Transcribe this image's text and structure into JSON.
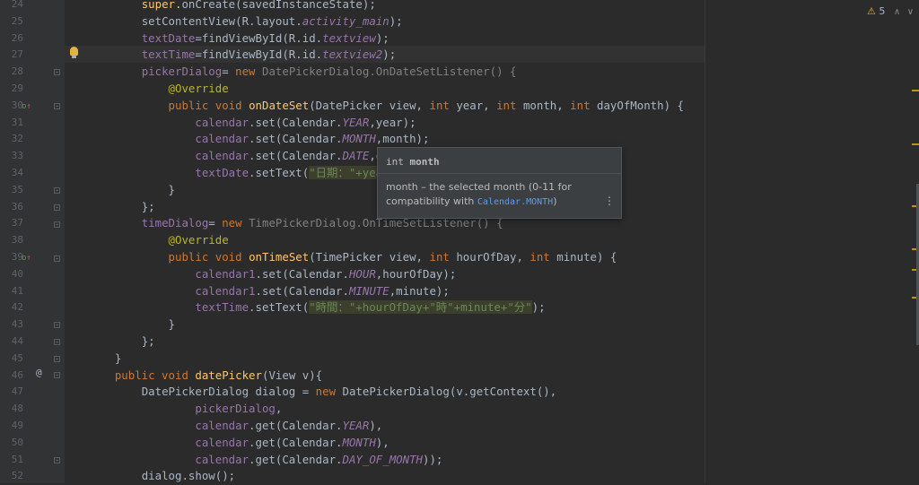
{
  "inspections": {
    "warning_count": "5"
  },
  "lines": [
    {
      "num": "24",
      "fold": false,
      "parts": [
        {
          "t": "super.",
          "c": "fn-plain"
        },
        {
          "t": "onCreate",
          "c": ""
        },
        {
          "t": "(savedInstanceState);",
          "c": ""
        }
      ],
      "indent": "        "
    },
    {
      "num": "25",
      "parts": [
        {
          "t": "setContentView(R.layout.",
          "c": ""
        },
        {
          "t": "activity_main",
          "c": "fi"
        },
        {
          "t": ");",
          "c": ""
        }
      ],
      "indent": "        "
    },
    {
      "num": "26",
      "parts": [
        {
          "t": "textDate",
          "c": "fld"
        },
        {
          "t": "=findViewById(R.id.",
          "c": ""
        },
        {
          "t": "textview",
          "c": "fi"
        },
        {
          "t": ");",
          "c": ""
        }
      ],
      "indent": "        "
    },
    {
      "num": "27",
      "parts": [
        {
          "t": "textTime",
          "c": "fld"
        },
        {
          "t": "=findViewById(R.id.",
          "c": ""
        },
        {
          "t": "textview2",
          "c": "fi"
        },
        {
          "t": ");",
          "c": ""
        }
      ],
      "indent": "        "
    },
    {
      "num": "28",
      "parts": [
        {
          "t": "pickerDialog",
          "c": "fld"
        },
        {
          "t": "= ",
          "c": ""
        },
        {
          "t": "new ",
          "c": "kw"
        },
        {
          "t": "DatePickerDialog.OnDateSetListener",
          "c": "gr"
        },
        {
          "t": "() {",
          "c": "gr"
        }
      ],
      "indent": "        "
    },
    {
      "num": "29",
      "parts": [
        {
          "t": "@Override",
          "c": "ann"
        }
      ],
      "indent": "            "
    },
    {
      "num": "30",
      "parts": [
        {
          "t": "public void ",
          "c": "kw"
        },
        {
          "t": "onDateSet",
          "c": "fn"
        },
        {
          "t": "(DatePicker view, ",
          "c": ""
        },
        {
          "t": "int ",
          "c": "kw"
        },
        {
          "t": "year, ",
          "c": ""
        },
        {
          "t": "int ",
          "c": "kw"
        },
        {
          "t": "month, ",
          "c": ""
        },
        {
          "t": "int ",
          "c": "kw"
        },
        {
          "t": "dayOfMonth) {",
          "c": ""
        }
      ],
      "indent": "            "
    },
    {
      "num": "31",
      "parts": [
        {
          "t": "calendar",
          "c": "fld"
        },
        {
          "t": ".set(Calendar.",
          "c": ""
        },
        {
          "t": "YEAR",
          "c": "fi"
        },
        {
          "t": ",year);",
          "c": ""
        }
      ],
      "indent": "                "
    },
    {
      "num": "32",
      "parts": [
        {
          "t": "calendar",
          "c": "fld"
        },
        {
          "t": ".set(Calendar.",
          "c": ""
        },
        {
          "t": "MONTH",
          "c": "fi"
        },
        {
          "t": ",month);",
          "c": ""
        }
      ],
      "indent": "                "
    },
    {
      "num": "33",
      "parts": [
        {
          "t": "calendar",
          "c": "fld"
        },
        {
          "t": ".set(Calendar.",
          "c": ""
        },
        {
          "t": "DATE",
          "c": "fi"
        },
        {
          "t": ",dayOfM",
          "c": ""
        }
      ],
      "indent": "                "
    },
    {
      "num": "34",
      "parts": [
        {
          "t": "textDate",
          "c": "fld"
        },
        {
          "t": ".setText(",
          "c": ""
        },
        {
          "t": "\"日期：\"",
          "c": "str-hl"
        },
        {
          "t": "+year+",
          "c": "str-hl"
        },
        {
          "t": "\"/\"",
          "c": "str-hl"
        }
      ],
      "indent": "                "
    },
    {
      "num": "35",
      "parts": [
        {
          "t": "}",
          "c": ""
        }
      ],
      "indent": "            "
    },
    {
      "num": "36",
      "parts": [
        {
          "t": "};",
          "c": ""
        }
      ],
      "indent": "        "
    },
    {
      "num": "37",
      "parts": [
        {
          "t": "timeDialog",
          "c": "fld"
        },
        {
          "t": "= ",
          "c": ""
        },
        {
          "t": "new ",
          "c": "kw"
        },
        {
          "t": "TimePickerDialog.OnTimeSetListener",
          "c": "gr"
        },
        {
          "t": "() {",
          "c": "gr"
        }
      ],
      "indent": "        "
    },
    {
      "num": "38",
      "parts": [
        {
          "t": "@Override",
          "c": "ann"
        }
      ],
      "indent": "            "
    },
    {
      "num": "39",
      "parts": [
        {
          "t": "public void ",
          "c": "kw"
        },
        {
          "t": "onTimeSet",
          "c": "fn"
        },
        {
          "t": "(TimePicker view, ",
          "c": ""
        },
        {
          "t": "int ",
          "c": "kw"
        },
        {
          "t": "hourOfDay, ",
          "c": ""
        },
        {
          "t": "int ",
          "c": "kw"
        },
        {
          "t": "minute) {",
          "c": ""
        }
      ],
      "indent": "            "
    },
    {
      "num": "40",
      "parts": [
        {
          "t": "calendar1",
          "c": "fld"
        },
        {
          "t": ".set(Calendar.",
          "c": ""
        },
        {
          "t": "HOUR",
          "c": "fi"
        },
        {
          "t": ",hourOfDay);",
          "c": ""
        }
      ],
      "indent": "                "
    },
    {
      "num": "41",
      "parts": [
        {
          "t": "calendar1",
          "c": "fld"
        },
        {
          "t": ".set(Calendar.",
          "c": ""
        },
        {
          "t": "MINUTE",
          "c": "fi"
        },
        {
          "t": ",minute);",
          "c": ""
        }
      ],
      "indent": "                "
    },
    {
      "num": "42",
      "parts": [
        {
          "t": "textTime",
          "c": "fld"
        },
        {
          "t": ".setText(",
          "c": ""
        },
        {
          "t": "\"時間：\"+hourOfDay+\"時\"+minute+\"分\"",
          "c": "str-hl"
        },
        {
          "t": ");",
          "c": ""
        }
      ],
      "indent": "                "
    },
    {
      "num": "43",
      "parts": [
        {
          "t": "}",
          "c": ""
        }
      ],
      "indent": "            "
    },
    {
      "num": "44",
      "parts": [
        {
          "t": "};",
          "c": ""
        }
      ],
      "indent": "        "
    },
    {
      "num": "45",
      "parts": [
        {
          "t": "}",
          "c": ""
        }
      ],
      "indent": "    "
    },
    {
      "num": "46",
      "parts": [
        {
          "t": "public void ",
          "c": "kw"
        },
        {
          "t": "datePicker",
          "c": "fn"
        },
        {
          "t": "(View v){",
          "c": ""
        }
      ],
      "indent": "    "
    },
    {
      "num": "47",
      "parts": [
        {
          "t": "DatePickerDialog dialog = ",
          "c": ""
        },
        {
          "t": "new ",
          "c": "kw"
        },
        {
          "t": "DatePickerDialog(v.getContext(),",
          "c": ""
        }
      ],
      "indent": "        "
    },
    {
      "num": "48",
      "parts": [
        {
          "t": "pickerDialog",
          "c": "fld"
        },
        {
          "t": ",",
          "c": ""
        }
      ],
      "indent": "                "
    },
    {
      "num": "49",
      "parts": [
        {
          "t": "calendar",
          "c": "fld"
        },
        {
          "t": ".get(Calendar.",
          "c": ""
        },
        {
          "t": "YEAR",
          "c": "fi"
        },
        {
          "t": "),",
          "c": ""
        }
      ],
      "indent": "                "
    },
    {
      "num": "50",
      "parts": [
        {
          "t": "calendar",
          "c": "fld"
        },
        {
          "t": ".get(Calendar.",
          "c": ""
        },
        {
          "t": "MONTH",
          "c": "fi"
        },
        {
          "t": "),",
          "c": ""
        }
      ],
      "indent": "                "
    },
    {
      "num": "51",
      "parts": [
        {
          "t": "calendar",
          "c": "fld"
        },
        {
          "t": ".get(Calendar.",
          "c": ""
        },
        {
          "t": "DAY_OF_MONTH",
          "c": "fi"
        },
        {
          "t": "));",
          "c": ""
        }
      ],
      "indent": "                "
    },
    {
      "num": "52",
      "parts": [
        {
          "t": "dialog.show();",
          "c": ""
        }
      ],
      "indent": "        "
    }
  ],
  "popup": {
    "signature_type": "int",
    "signature_name": "month",
    "description": "month – the selected month (0-11 for compatibility with",
    "link": "Calendar.MONTH",
    "description_end": ")",
    "more": "⋮"
  },
  "colors": {
    "keyword": "#cc7832",
    "field": "#9876aa",
    "method": "#ffc66d",
    "annotation": "#bbb529",
    "string": "#6a8759",
    "text": "#a9b7c6"
  }
}
